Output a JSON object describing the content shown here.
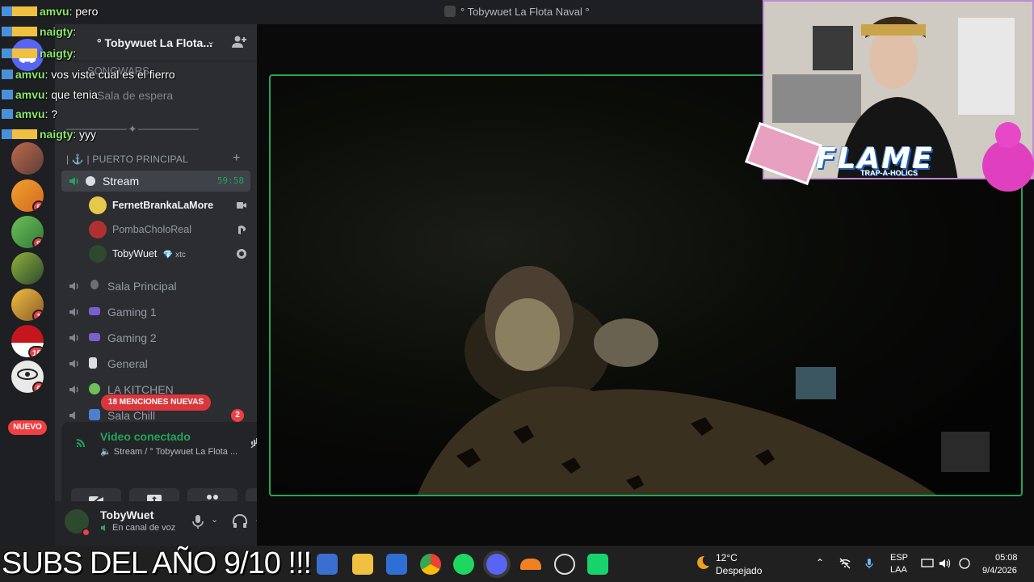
{
  "window": {
    "title": "° Tobywuet La Flota Naval °"
  },
  "chat_overlay": [
    {
      "user": "amvu",
      "message": "pero"
    },
    {
      "user": "naigty",
      "message": ""
    },
    {
      "user": "naigty",
      "message": ""
    },
    {
      "user": "amvu",
      "message": "vos viste cual es el fierro"
    },
    {
      "user": "amvu",
      "message": "que tenia"
    },
    {
      "user": "amvu",
      "message": "?"
    },
    {
      "user": "naigty",
      "message": "yyy"
    }
  ],
  "rail": {
    "servers": [
      {
        "badge": ""
      },
      {
        "badge": "5"
      },
      {
        "badge": "9"
      },
      {
        "badge": ""
      },
      {
        "badge": "1"
      },
      {
        "badge": "16"
      },
      {
        "badge": "6"
      }
    ],
    "new_label": "NUEVO"
  },
  "server": {
    "name": "° Tobywuet La Flota...",
    "faded_category": "SONGWARS",
    "faded_channel": "Sala de espera",
    "divider": "───────── ✦ ─────────",
    "category": "| ⚓ | PUERTO PRINCIPAL",
    "channels": {
      "stream": {
        "name": "Stream",
        "timer": "59:58"
      },
      "sala_principal": "Sala Principal",
      "gaming1": "Gaming 1",
      "gaming2": "Gaming 2",
      "general": "General",
      "kitchen": "LA KITCHEN",
      "chill": "Sala Chill"
    },
    "voice_members": [
      {
        "name": "FernetBrankaLaMore",
        "color": "#f2f3f5"
      },
      {
        "name": "PombaCholoReal",
        "color": "#949ba4"
      },
      {
        "name": "TobyWuet",
        "color": "#f2f3f5",
        "tag": "xtc"
      }
    ],
    "mentions_pill": "18 MENCIONES NUEVAS",
    "chill_badge": "2"
  },
  "voice_panel": {
    "status": "Video conectado",
    "location": "Stream / ° Tobywuet La Flota ..."
  },
  "user_panel": {
    "name": "TobyWuet",
    "status": "En canal de voz"
  },
  "overlay": {
    "brand": "FLAME",
    "brand_sub": "TRAP-A-HOLICS",
    "banner": "SUBS DEL AÑO 9/10 !!!"
  },
  "taskbar": {
    "temperature": "12°C",
    "weather": "Despejado",
    "lang": "ESP",
    "layout": "LAA",
    "time": "05:08",
    "date": "9/4/2026"
  },
  "colors": {
    "accent": "#23a55a",
    "danger": "#f23f43",
    "sidebar": "#2b2d31",
    "rail": "#1e1f22"
  }
}
